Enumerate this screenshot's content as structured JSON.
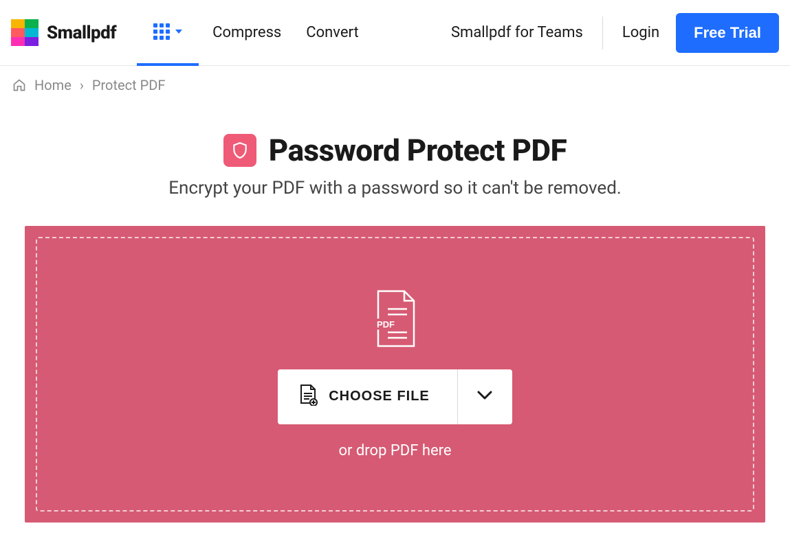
{
  "brand": {
    "name": "Smallpdf"
  },
  "nav": {
    "compress": "Compress",
    "convert": "Convert",
    "teams": "Smallpdf for Teams",
    "login": "Login",
    "free_trial": "Free Trial"
  },
  "breadcrumb": {
    "home": "Home",
    "current": "Protect PDF",
    "separator": "›"
  },
  "hero": {
    "title": "Password Protect PDF",
    "subtitle": "Encrypt your PDF with a password so it can't be removed."
  },
  "dropzone": {
    "pdf_label": "PDF",
    "choose_file": "CHOOSE FILE",
    "drop_text": "or drop PDF here"
  }
}
